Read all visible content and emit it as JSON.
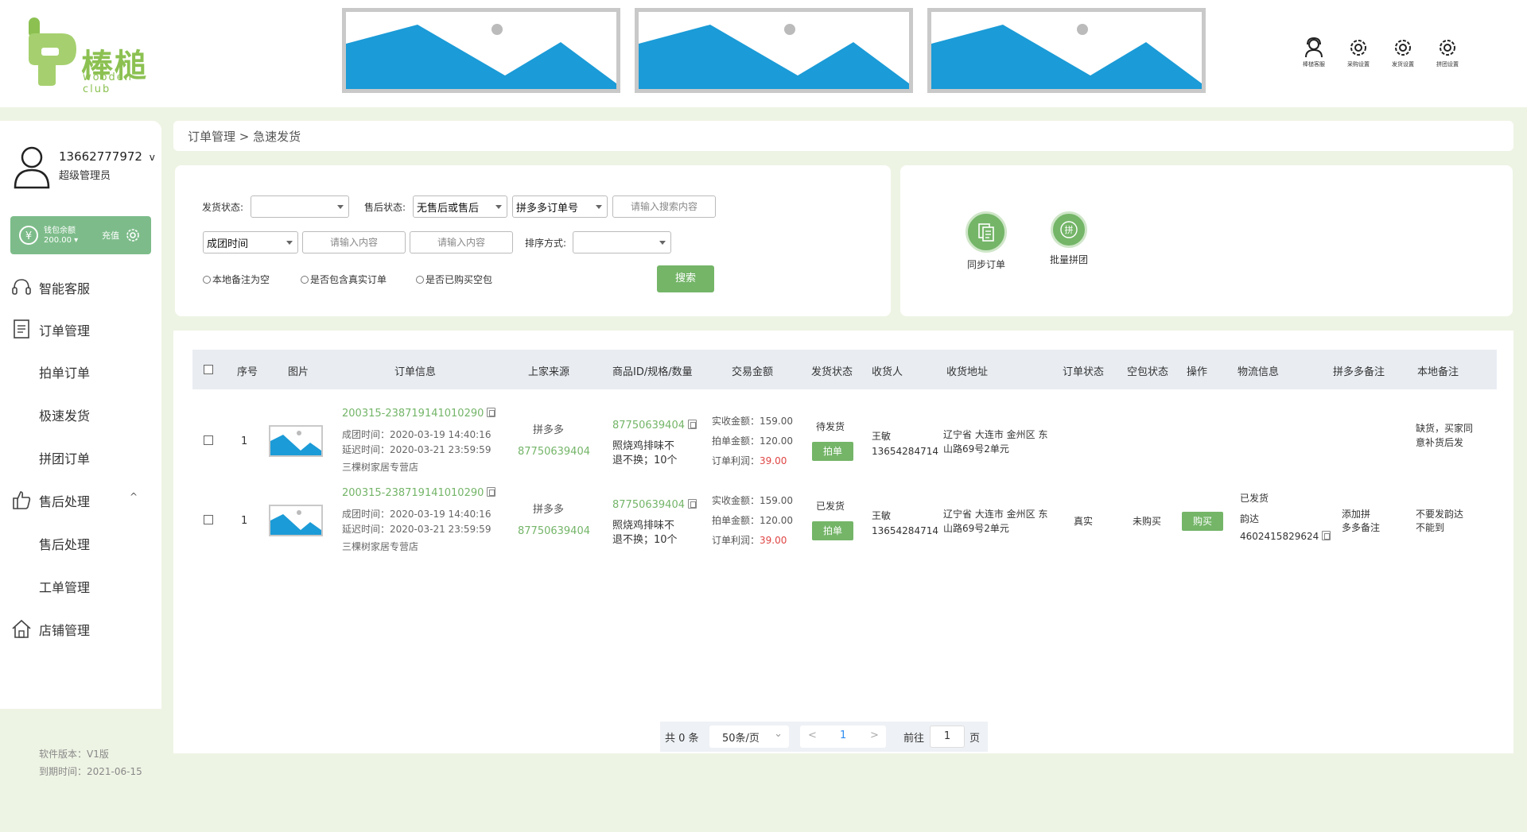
{
  "header": {
    "logo": {
      "text": "棒槌",
      "subtext": "wooden club"
    },
    "banners": [
      "banner-1",
      "banner-2",
      "banner-3"
    ],
    "top_icons": [
      {
        "icon": "user-service-icon",
        "label": "棒槌客服"
      },
      {
        "icon": "gear-icon",
        "label": "采购设置"
      },
      {
        "icon": "gear-icon",
        "label": "发货设置"
      },
      {
        "icon": "gear-icon",
        "label": "拼团设置"
      }
    ]
  },
  "sidebar": {
    "user": {
      "phone": "13662777972",
      "caret": "v",
      "role": "超级管理员"
    },
    "wallet": {
      "label": "钱包余额",
      "amount": "200.00 ▾",
      "recharge": "充值"
    },
    "menu": [
      {
        "icon": "headset-icon",
        "label": "智能客服"
      },
      {
        "icon": "document-icon",
        "label": "订单管理"
      },
      {
        "label": "拍单订单",
        "sub": true
      },
      {
        "label": "极速发货",
        "sub": true
      },
      {
        "label": "拼团订单",
        "sub": true
      },
      {
        "icon": "thumbs-up-icon",
        "label": "售后处理",
        "caret": "^"
      },
      {
        "label": "售后处理",
        "sub": true
      },
      {
        "label": "工单管理",
        "sub": true
      },
      {
        "icon": "home-icon",
        "label": "店铺管理"
      }
    ],
    "version": "软件版本：V1版",
    "expire": "到期时间：2021-06-15"
  },
  "breadcrumb": "订单管理 > 急速发货",
  "filters": {
    "ship_status_label": "发货状态:",
    "ship_status_value": "",
    "after_sale_label": "售后状态:",
    "after_sale_value": "无售后或售后",
    "order_type_value": "拼多多订单号",
    "search_placeholder": "请输入搜索内容",
    "time_type_value": "成团时间",
    "input1_placeholder": "请输入内容",
    "input2_placeholder": "请输入内容",
    "sort_label": "排序方式:",
    "sort_value": "",
    "radio1": "本地备注为空",
    "radio2": "是否包含真实订单",
    "radio3": "是否已购买空包",
    "search_button": "搜索"
  },
  "actions": [
    {
      "icon": "sync-document-icon",
      "label": "同步订单"
    },
    {
      "icon": "group-buy-icon",
      "glyph": "拼",
      "label": "批量拼团"
    }
  ],
  "table": {
    "headers": [
      "序号",
      "图片",
      "订单信息",
      "上家来源",
      "商品ID/规格/数量",
      "交易金额",
      "发货状态",
      "收货人",
      "收货地址",
      "订单状态",
      "空包状态",
      "操作",
      "物流信息",
      "拼多多备注",
      "本地备注"
    ],
    "rows": [
      {
        "index": "1",
        "order_no": "200315-238719141010290",
        "group_time": "成团时间：2020-03-19 14:40:16",
        "delay_time": "延迟时间：2020-03-21 23:59:59",
        "shop": "三棵树家居专营店",
        "source": "拼多多",
        "source_id": "87750639404",
        "goods_id": "87750639404",
        "goods_spec1": "照烧鸡排味不",
        "goods_spec2": "退不换；10个",
        "paid": "实收金额：159.00",
        "bid": "拍单金额：120.00",
        "profit_label": "订单利润：",
        "profit_value": "39.00",
        "ship_status": "待发货",
        "ship_button": "拍单",
        "receiver_name": "王敏",
        "receiver_phone": "13654284714",
        "address1": "辽宁省 大连市 金州区 东",
        "address2": "山路69号2单元",
        "order_status": "",
        "empty_status": "",
        "operation": "",
        "logistics1": "",
        "logistics2": "",
        "logistics3": "",
        "pdd_note1": "",
        "pdd_note2": "",
        "local_note1": "缺货，买家同",
        "local_note2": "意补货后发"
      },
      {
        "index": "1",
        "order_no": "200315-238719141010290",
        "group_time": "成团时间：2020-03-19 14:40:16",
        "delay_time": "延迟时间：2020-03-21 23:59:59",
        "shop": "三棵树家居专营店",
        "source": "拼多多",
        "source_id": "87750639404",
        "goods_id": "87750639404",
        "goods_spec1": "照烧鸡排味不",
        "goods_spec2": "退不换；10个",
        "paid": "实收金额：159.00",
        "bid": "拍单金额：120.00",
        "profit_label": "订单利润：",
        "profit_value": "39.00",
        "ship_status": "已发货",
        "ship_button": "拍单",
        "receiver_name": "王敏",
        "receiver_phone": "13654284714",
        "address1": "辽宁省 大连市 金州区 东",
        "address2": "山路69号2单元",
        "order_status": "真实",
        "empty_status": "未购买",
        "operation": "购买",
        "logistics1": "已发货",
        "logistics2": "韵达",
        "logistics3": "4602415829624",
        "pdd_note1": "添加拼",
        "pdd_note2": "多多备注",
        "local_note1": "不要发韵达",
        "local_note2": "不能到"
      }
    ]
  },
  "pagination": {
    "total": "共 0 条",
    "page_size": "50条/页",
    "prev": "<",
    "current": "1",
    "next": ">",
    "goto_label": "前往",
    "goto_value": "1",
    "page_label": "页"
  },
  "colors": {
    "accent": "#74b568",
    "brand": "#8cc152",
    "image_blue": "#1b9bd7",
    "profit_red": "#e04545",
    "page_bg": "#eef4e4"
  }
}
